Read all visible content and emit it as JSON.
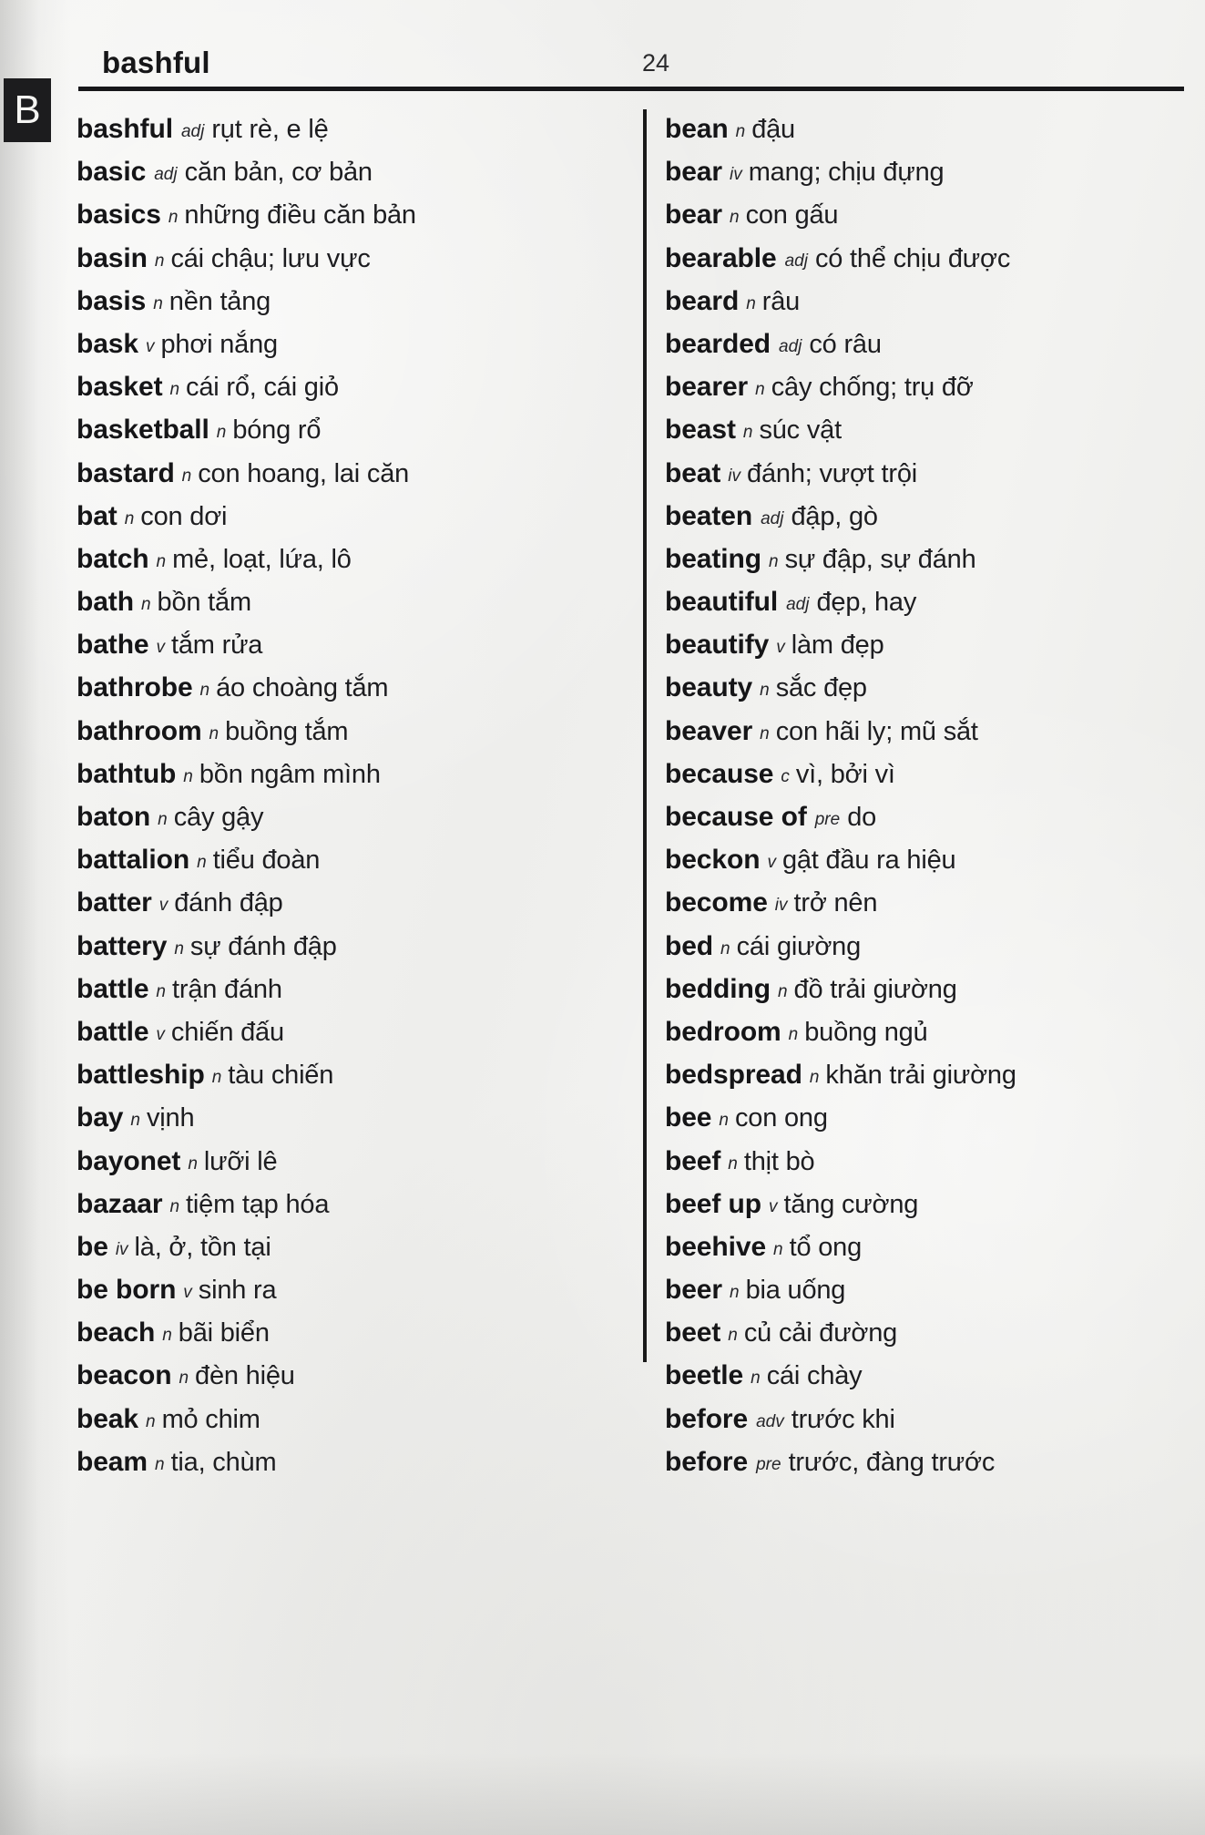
{
  "page": {
    "running_head": "bashful",
    "folio": "24",
    "thumb_tab_letter": "B"
  },
  "columns": {
    "left": [
      {
        "headword": "bashful",
        "pos": "adj",
        "definition": "rụt rè, e lệ"
      },
      {
        "headword": "basic",
        "pos": "adj",
        "definition": "căn bản, cơ bản"
      },
      {
        "headword": "basics",
        "pos": "n",
        "definition": "những điều căn bản"
      },
      {
        "headword": "basin",
        "pos": "n",
        "definition": "cái chậu; lưu vực"
      },
      {
        "headword": "basis",
        "pos": "n",
        "definition": "nền tảng"
      },
      {
        "headword": "bask",
        "pos": "v",
        "definition": "phơi nắng"
      },
      {
        "headword": "basket",
        "pos": "n",
        "definition": "cái rổ, cái giỏ"
      },
      {
        "headword": "basketball",
        "pos": "n",
        "definition": "bóng rổ"
      },
      {
        "headword": "bastard",
        "pos": "n",
        "definition": "con hoang, lai căn"
      },
      {
        "headword": "bat",
        "pos": "n",
        "definition": "con dơi"
      },
      {
        "headword": "batch",
        "pos": "n",
        "definition": "mẻ, loạt, lứa, lô"
      },
      {
        "headword": "bath",
        "pos": "n",
        "definition": "bồn tắm"
      },
      {
        "headword": "bathe",
        "pos": "v",
        "definition": "tắm rửa"
      },
      {
        "headword": "bathrobe",
        "pos": "n",
        "definition": "áo choàng tắm"
      },
      {
        "headword": "bathroom",
        "pos": "n",
        "definition": "buồng tắm"
      },
      {
        "headword": "bathtub",
        "pos": "n",
        "definition": "bồn ngâm mình"
      },
      {
        "headword": "baton",
        "pos": "n",
        "definition": "cây gậy"
      },
      {
        "headword": "battalion",
        "pos": "n",
        "definition": "tiểu đoàn"
      },
      {
        "headword": "batter",
        "pos": "v",
        "definition": "đánh đập"
      },
      {
        "headword": "battery",
        "pos": "n",
        "definition": "sự đánh đập"
      },
      {
        "headword": "battle",
        "pos": "n",
        "definition": "trận đánh"
      },
      {
        "headword": "battle",
        "pos": "v",
        "definition": "chiến đấu"
      },
      {
        "headword": "battleship",
        "pos": "n",
        "definition": "tàu chiến"
      },
      {
        "headword": "bay",
        "pos": "n",
        "definition": "vịnh"
      },
      {
        "headword": "bayonet",
        "pos": "n",
        "definition": "lưỡi lê"
      },
      {
        "headword": "bazaar",
        "pos": "n",
        "definition": "tiệm tạp hóa"
      },
      {
        "headword": "be",
        "pos": "iv",
        "definition": "là, ở, tồn tại"
      },
      {
        "headword": "be born",
        "pos": "v",
        "definition": "sinh ra"
      },
      {
        "headword": "beach",
        "pos": "n",
        "definition": "bãi biển"
      },
      {
        "headword": "beacon",
        "pos": "n",
        "definition": "đèn hiệu"
      },
      {
        "headword": "beak",
        "pos": "n",
        "definition": "mỏ chim"
      },
      {
        "headword": "beam",
        "pos": "n",
        "definition": "tia, chùm"
      }
    ],
    "right": [
      {
        "headword": "bean",
        "pos": "n",
        "definition": "đậu"
      },
      {
        "headword": "bear",
        "pos": "iv",
        "definition": "mang; chịu đựng"
      },
      {
        "headword": "bear",
        "pos": "n",
        "definition": "con gấu"
      },
      {
        "headword": "bearable",
        "pos": "adj",
        "definition": "có thể chịu được"
      },
      {
        "headword": "beard",
        "pos": "n",
        "definition": "râu"
      },
      {
        "headword": "bearded",
        "pos": "adj",
        "definition": "có râu"
      },
      {
        "headword": "bearer",
        "pos": "n",
        "definition": "cây chống; trụ đỡ"
      },
      {
        "headword": "beast",
        "pos": "n",
        "definition": "súc vật"
      },
      {
        "headword": "beat",
        "pos": "iv",
        "definition": "đánh; vượt trội"
      },
      {
        "headword": "beaten",
        "pos": "adj",
        "definition": "đập, gò"
      },
      {
        "headword": "beating",
        "pos": "n",
        "definition": "sự đập, sự đánh"
      },
      {
        "headword": "beautiful",
        "pos": "adj",
        "definition": "đẹp, hay"
      },
      {
        "headword": "beautify",
        "pos": "v",
        "definition": "làm đẹp"
      },
      {
        "headword": "beauty",
        "pos": "n",
        "definition": "sắc đẹp"
      },
      {
        "headword": "beaver",
        "pos": "n",
        "definition": "con hãi ly; mũ sắt"
      },
      {
        "headword": "because",
        "pos": "c",
        "definition": "vì, bởi vì"
      },
      {
        "headword": "because of",
        "pos": "pre",
        "definition": "do"
      },
      {
        "headword": "beckon",
        "pos": "v",
        "definition": "gật đầu ra hiệu"
      },
      {
        "headword": "become",
        "pos": "iv",
        "definition": "trở nên"
      },
      {
        "headword": "bed",
        "pos": "n",
        "definition": "cái giường"
      },
      {
        "headword": "bedding",
        "pos": "n",
        "definition": "đồ trải giường"
      },
      {
        "headword": "bedroom",
        "pos": "n",
        "definition": "buồng ngủ"
      },
      {
        "headword": "bedspread",
        "pos": "n",
        "definition": "khăn trải giường"
      },
      {
        "headword": "bee",
        "pos": "n",
        "definition": "con ong"
      },
      {
        "headword": "beef",
        "pos": "n",
        "definition": "thịt bò"
      },
      {
        "headword": "beef up",
        "pos": "v",
        "definition": "tăng cường"
      },
      {
        "headword": "beehive",
        "pos": "n",
        "definition": "tổ ong"
      },
      {
        "headword": "beer",
        "pos": "n",
        "definition": "bia uống"
      },
      {
        "headword": "beet",
        "pos": "n",
        "definition": "củ cải đường"
      },
      {
        "headword": "beetle",
        "pos": "n",
        "definition": "cái chày"
      },
      {
        "headword": "before",
        "pos": "adv",
        "definition": "trước khi"
      },
      {
        "headword": "before",
        "pos": "pre",
        "definition": "trước, đàng trước"
      }
    ]
  },
  "colors": {
    "paper": "#f2f2f0",
    "ink": "#17171a",
    "tab_background": "#1c1c1e",
    "tab_letter": "#f4f4f2"
  }
}
